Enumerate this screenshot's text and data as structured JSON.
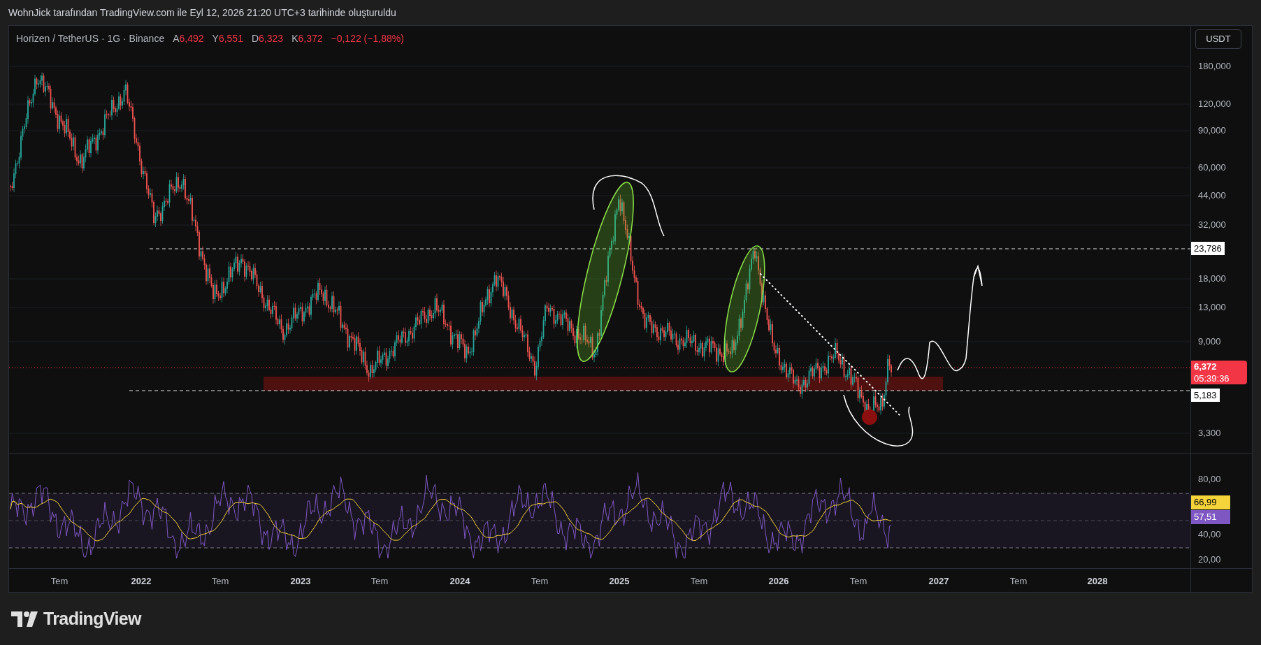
{
  "attribution": "WohnJick tarafından TradingView.com ile Eyl 12, 2026 21:20 UTC+3 tarihinde oluşturuldu",
  "chart": {
    "legend": {
      "symbol": "Horizen / TetherUS · 1G · Binance",
      "ohlc": [
        {
          "label": "A",
          "value": "6,492"
        },
        {
          "label": "Y",
          "value": "6,551"
        },
        {
          "label": "D",
          "value": "6,323"
        },
        {
          "label": "K",
          "value": "6,372"
        }
      ],
      "change": "−0,122 (−1,88%)"
    },
    "currency_button": "USDT",
    "price_axis": [
      "180,000",
      "120,000",
      "90,000",
      "60,000",
      "44,000",
      "32,000",
      "18,000",
      "13,000",
      "9,000",
      "3,300"
    ],
    "price_tags": [
      {
        "kind": "level",
        "text": "23,786"
      },
      {
        "kind": "last",
        "text": "6,372",
        "countdown": "05:39:36"
      },
      {
        "kind": "level",
        "text": "5,183"
      }
    ],
    "rsi_axis": [
      "80,00",
      "40,00",
      "20,00"
    ],
    "rsi_tags": [
      {
        "kind": "ma",
        "text": "66,99",
        "color": "#f5d33b"
      },
      {
        "kind": "rsi",
        "text": "57,51",
        "color": "#7e57c2"
      }
    ],
    "time_axis": [
      {
        "kind": "month",
        "label": "Tem"
      },
      {
        "kind": "year",
        "label": "2022"
      },
      {
        "kind": "month",
        "label": "Tem"
      },
      {
        "kind": "year",
        "label": "2023"
      },
      {
        "kind": "month",
        "label": "Tem"
      },
      {
        "kind": "year",
        "label": "2024"
      },
      {
        "kind": "month",
        "label": "Tem"
      },
      {
        "kind": "year",
        "label": "2025"
      },
      {
        "kind": "month",
        "label": "Tem"
      },
      {
        "kind": "year",
        "label": "2026"
      },
      {
        "kind": "month",
        "label": "Tem"
      },
      {
        "kind": "year",
        "label": "2027"
      },
      {
        "kind": "month",
        "label": "Tem"
      },
      {
        "kind": "year",
        "label": "2028"
      }
    ]
  },
  "logo": {
    "text": "TradingView"
  }
}
